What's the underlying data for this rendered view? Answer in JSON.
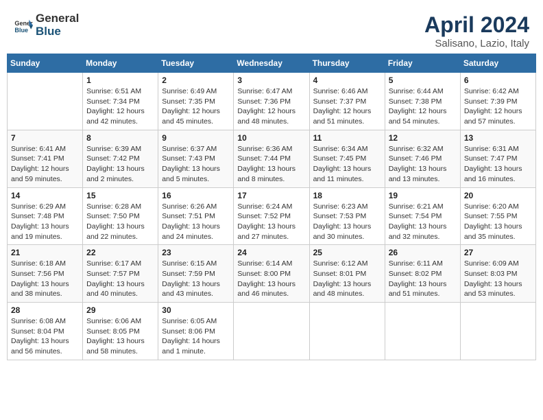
{
  "header": {
    "logo_general": "General",
    "logo_blue": "Blue",
    "title": "April 2024",
    "location": "Salisano, Lazio, Italy"
  },
  "weekdays": [
    "Sunday",
    "Monday",
    "Tuesday",
    "Wednesday",
    "Thursday",
    "Friday",
    "Saturday"
  ],
  "weeks": [
    [
      {
        "day": "",
        "sunrise": "",
        "sunset": "",
        "daylight": ""
      },
      {
        "day": "1",
        "sunrise": "Sunrise: 6:51 AM",
        "sunset": "Sunset: 7:34 PM",
        "daylight": "Daylight: 12 hours and 42 minutes."
      },
      {
        "day": "2",
        "sunrise": "Sunrise: 6:49 AM",
        "sunset": "Sunset: 7:35 PM",
        "daylight": "Daylight: 12 hours and 45 minutes."
      },
      {
        "day": "3",
        "sunrise": "Sunrise: 6:47 AM",
        "sunset": "Sunset: 7:36 PM",
        "daylight": "Daylight: 12 hours and 48 minutes."
      },
      {
        "day": "4",
        "sunrise": "Sunrise: 6:46 AM",
        "sunset": "Sunset: 7:37 PM",
        "daylight": "Daylight: 12 hours and 51 minutes."
      },
      {
        "day": "5",
        "sunrise": "Sunrise: 6:44 AM",
        "sunset": "Sunset: 7:38 PM",
        "daylight": "Daylight: 12 hours and 54 minutes."
      },
      {
        "day": "6",
        "sunrise": "Sunrise: 6:42 AM",
        "sunset": "Sunset: 7:39 PM",
        "daylight": "Daylight: 12 hours and 57 minutes."
      }
    ],
    [
      {
        "day": "7",
        "sunrise": "Sunrise: 6:41 AM",
        "sunset": "Sunset: 7:41 PM",
        "daylight": "Daylight: 12 hours and 59 minutes."
      },
      {
        "day": "8",
        "sunrise": "Sunrise: 6:39 AM",
        "sunset": "Sunset: 7:42 PM",
        "daylight": "Daylight: 13 hours and 2 minutes."
      },
      {
        "day": "9",
        "sunrise": "Sunrise: 6:37 AM",
        "sunset": "Sunset: 7:43 PM",
        "daylight": "Daylight: 13 hours and 5 minutes."
      },
      {
        "day": "10",
        "sunrise": "Sunrise: 6:36 AM",
        "sunset": "Sunset: 7:44 PM",
        "daylight": "Daylight: 13 hours and 8 minutes."
      },
      {
        "day": "11",
        "sunrise": "Sunrise: 6:34 AM",
        "sunset": "Sunset: 7:45 PM",
        "daylight": "Daylight: 13 hours and 11 minutes."
      },
      {
        "day": "12",
        "sunrise": "Sunrise: 6:32 AM",
        "sunset": "Sunset: 7:46 PM",
        "daylight": "Daylight: 13 hours and 13 minutes."
      },
      {
        "day": "13",
        "sunrise": "Sunrise: 6:31 AM",
        "sunset": "Sunset: 7:47 PM",
        "daylight": "Daylight: 13 hours and 16 minutes."
      }
    ],
    [
      {
        "day": "14",
        "sunrise": "Sunrise: 6:29 AM",
        "sunset": "Sunset: 7:48 PM",
        "daylight": "Daylight: 13 hours and 19 minutes."
      },
      {
        "day": "15",
        "sunrise": "Sunrise: 6:28 AM",
        "sunset": "Sunset: 7:50 PM",
        "daylight": "Daylight: 13 hours and 22 minutes."
      },
      {
        "day": "16",
        "sunrise": "Sunrise: 6:26 AM",
        "sunset": "Sunset: 7:51 PM",
        "daylight": "Daylight: 13 hours and 24 minutes."
      },
      {
        "day": "17",
        "sunrise": "Sunrise: 6:24 AM",
        "sunset": "Sunset: 7:52 PM",
        "daylight": "Daylight: 13 hours and 27 minutes."
      },
      {
        "day": "18",
        "sunrise": "Sunrise: 6:23 AM",
        "sunset": "Sunset: 7:53 PM",
        "daylight": "Daylight: 13 hours and 30 minutes."
      },
      {
        "day": "19",
        "sunrise": "Sunrise: 6:21 AM",
        "sunset": "Sunset: 7:54 PM",
        "daylight": "Daylight: 13 hours and 32 minutes."
      },
      {
        "day": "20",
        "sunrise": "Sunrise: 6:20 AM",
        "sunset": "Sunset: 7:55 PM",
        "daylight": "Daylight: 13 hours and 35 minutes."
      }
    ],
    [
      {
        "day": "21",
        "sunrise": "Sunrise: 6:18 AM",
        "sunset": "Sunset: 7:56 PM",
        "daylight": "Daylight: 13 hours and 38 minutes."
      },
      {
        "day": "22",
        "sunrise": "Sunrise: 6:17 AM",
        "sunset": "Sunset: 7:57 PM",
        "daylight": "Daylight: 13 hours and 40 minutes."
      },
      {
        "day": "23",
        "sunrise": "Sunrise: 6:15 AM",
        "sunset": "Sunset: 7:59 PM",
        "daylight": "Daylight: 13 hours and 43 minutes."
      },
      {
        "day": "24",
        "sunrise": "Sunrise: 6:14 AM",
        "sunset": "Sunset: 8:00 PM",
        "daylight": "Daylight: 13 hours and 46 minutes."
      },
      {
        "day": "25",
        "sunrise": "Sunrise: 6:12 AM",
        "sunset": "Sunset: 8:01 PM",
        "daylight": "Daylight: 13 hours and 48 minutes."
      },
      {
        "day": "26",
        "sunrise": "Sunrise: 6:11 AM",
        "sunset": "Sunset: 8:02 PM",
        "daylight": "Daylight: 13 hours and 51 minutes."
      },
      {
        "day": "27",
        "sunrise": "Sunrise: 6:09 AM",
        "sunset": "Sunset: 8:03 PM",
        "daylight": "Daylight: 13 hours and 53 minutes."
      }
    ],
    [
      {
        "day": "28",
        "sunrise": "Sunrise: 6:08 AM",
        "sunset": "Sunset: 8:04 PM",
        "daylight": "Daylight: 13 hours and 56 minutes."
      },
      {
        "day": "29",
        "sunrise": "Sunrise: 6:06 AM",
        "sunset": "Sunset: 8:05 PM",
        "daylight": "Daylight: 13 hours and 58 minutes."
      },
      {
        "day": "30",
        "sunrise": "Sunrise: 6:05 AM",
        "sunset": "Sunset: 8:06 PM",
        "daylight": "Daylight: 14 hours and 1 minute."
      },
      {
        "day": "",
        "sunrise": "",
        "sunset": "",
        "daylight": ""
      },
      {
        "day": "",
        "sunrise": "",
        "sunset": "",
        "daylight": ""
      },
      {
        "day": "",
        "sunrise": "",
        "sunset": "",
        "daylight": ""
      },
      {
        "day": "",
        "sunrise": "",
        "sunset": "",
        "daylight": ""
      }
    ]
  ]
}
